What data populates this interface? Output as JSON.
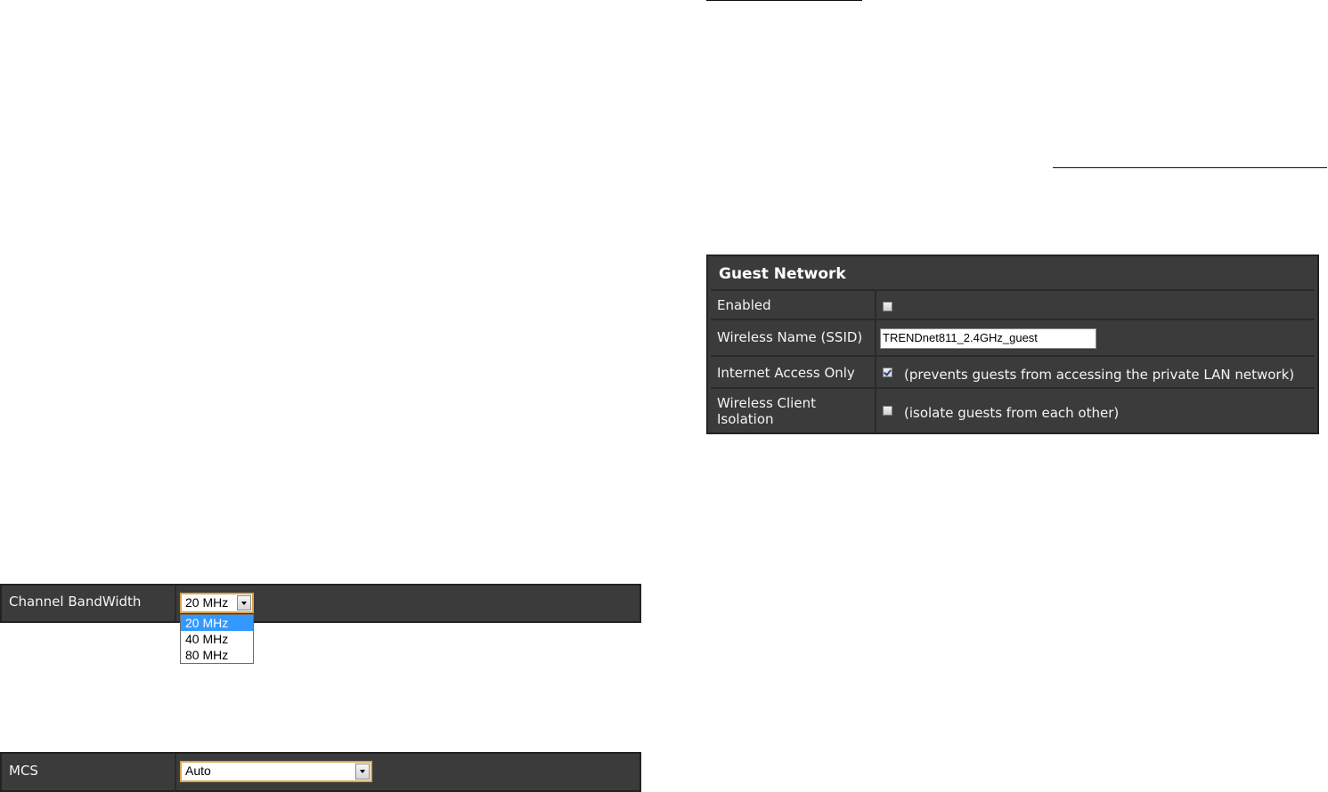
{
  "channel_bandwidth": {
    "label": "Channel BandWidth",
    "selected": "20 MHz",
    "options": [
      "20 MHz",
      "40 MHz",
      "80 MHz"
    ]
  },
  "mcs": {
    "label": "MCS",
    "selected": "Auto"
  },
  "guest_network": {
    "title": "Guest Network",
    "enabled": {
      "label": "Enabled",
      "checked": false
    },
    "ssid": {
      "label": "Wireless Name (SSID)",
      "value": "TRENDnet811_2.4GHz_guest"
    },
    "internet_access_only": {
      "label": "Internet Access Only",
      "checked": true,
      "note": "(prevents guests from accessing the private LAN network)"
    },
    "client_isolation": {
      "label_line1": "Wireless Client",
      "label_line2": "Isolation",
      "checked": false,
      "note": "(isolate guests from each other)"
    }
  },
  "icons": {
    "dropdown": "chevron-down-icon",
    "checkbox_checked": "checkmark-icon"
  },
  "colors": {
    "panel_bg": "#3b3b3b",
    "panel_border": "#222222",
    "select_border": "#d9a54e",
    "option_highlight": "#3399ff"
  }
}
